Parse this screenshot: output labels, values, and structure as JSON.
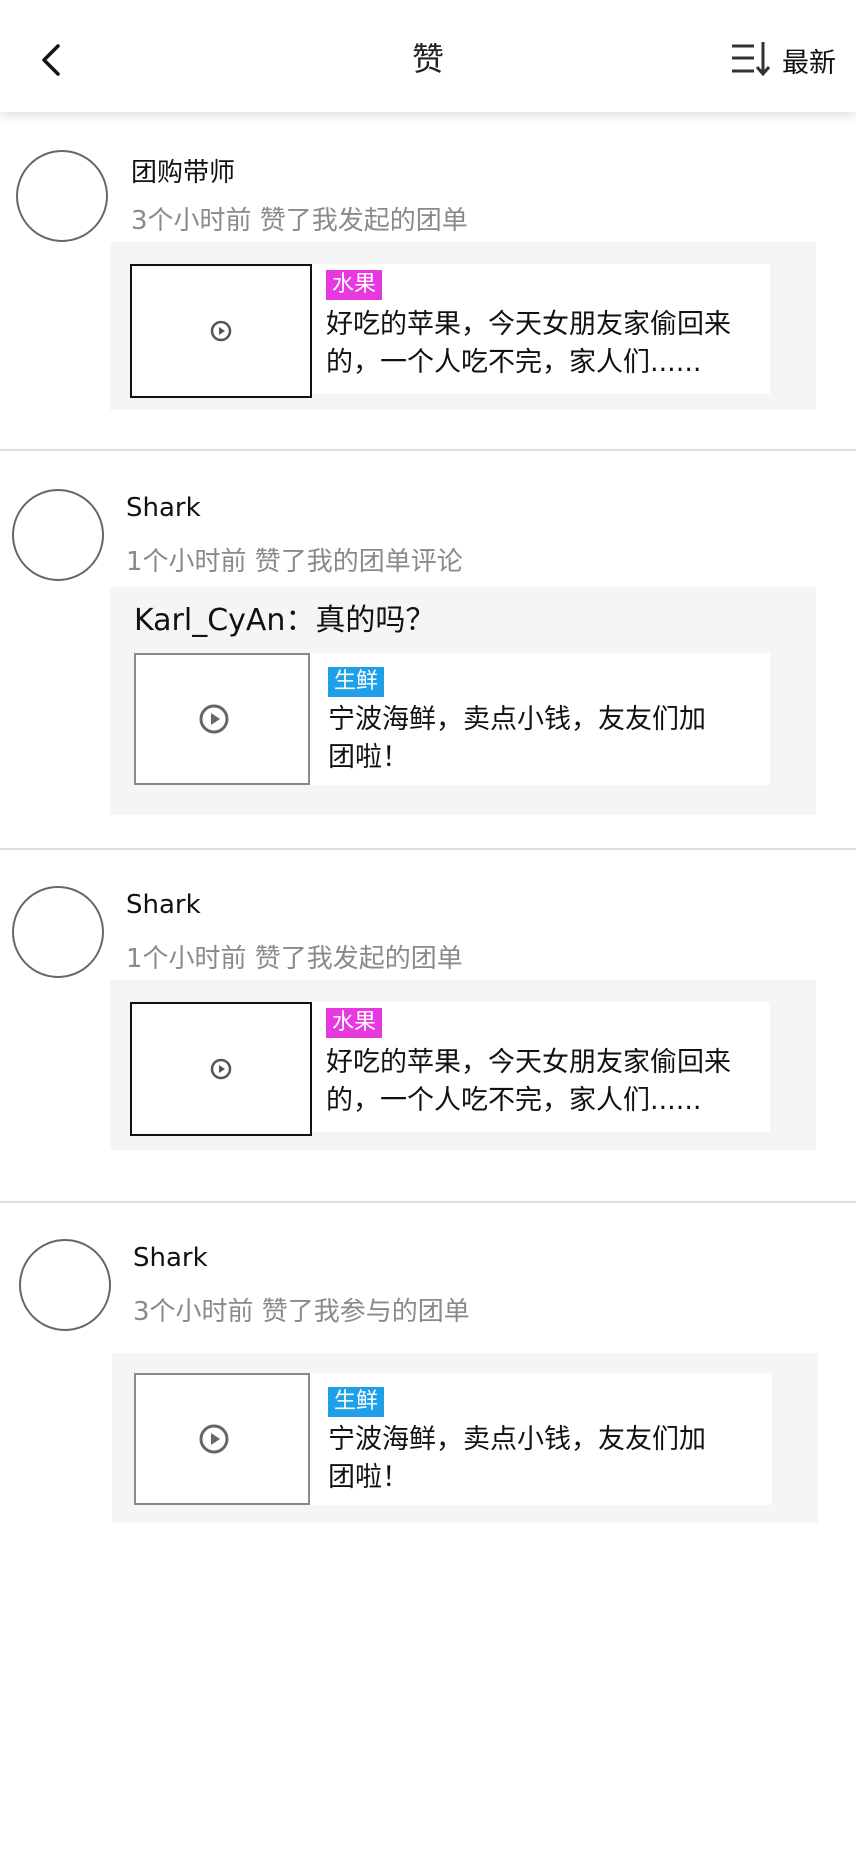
{
  "header": {
    "title": "赞",
    "sort_label": "最新"
  },
  "items": [
    {
      "user": "团购带师",
      "meta": "3个小时前 赞了我发起的团单",
      "comment": "",
      "post": {
        "tag": "水果",
        "tag_color": "#e838e0",
        "text_line1": "好吃的苹果，今天女朋友家偷回来",
        "text_line2": "的，一个人吃不完，家人们......"
      }
    },
    {
      "user": "Shark",
      "meta": "1个小时前 赞了我的团单评论",
      "comment": "Karl_CyAn：真的吗？",
      "post": {
        "tag": "生鲜",
        "tag_color": "#1e9fe8",
        "text_line1": "宁波海鲜，卖点小钱，友友们加",
        "text_line2": "团啦！"
      }
    },
    {
      "user": "Shark",
      "meta": "1个小时前 赞了我发起的团单",
      "comment": "",
      "post": {
        "tag": "水果",
        "tag_color": "#e838e0",
        "text_line1": "好吃的苹果，今天女朋友家偷回来",
        "text_line2": "的，一个人吃不完，家人们......"
      }
    },
    {
      "user": "Shark",
      "meta": "3个小时前 赞了我参与的团单",
      "comment": "",
      "post": {
        "tag": "生鲜",
        "tag_color": "#1e9fe8",
        "text_line1": "宁波海鲜，卖点小钱，友友们加",
        "text_line2": "团啦！"
      }
    }
  ]
}
